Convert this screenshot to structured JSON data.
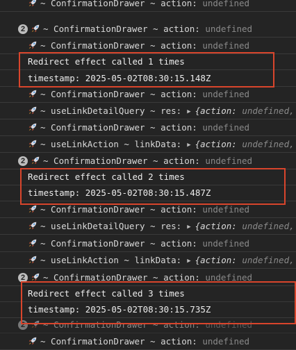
{
  "colors": {
    "background": "#242424",
    "text": "#e6e6e6",
    "undefined_text": "#8a8a8a",
    "highlight_box": "#d9452c",
    "badge_bg": "#bdbdbd"
  },
  "icons": {
    "log_prefix": "rocket-icon",
    "object_toggle": "triangle-right-icon"
  },
  "rows": [
    {
      "prefix": "~ ConfirmationDrawer ~ action:",
      "value": "undefined"
    },
    {
      "badge": "2",
      "prefix": "~ ConfirmationDrawer ~ action:",
      "value": "undefined"
    },
    {
      "prefix": "~ ConfirmationDrawer ~ action:",
      "value": "undefined"
    },
    {
      "message": "Redirect effect called 1 times"
    },
    {
      "message": "timestamp: 2025-05-02T08:30:15.148Z"
    },
    {
      "prefix": "~ ConfirmationDrawer ~ action:",
      "value": "undefined"
    },
    {
      "prefix": "~ useLinkDetailQuery ~ res:",
      "object": true,
      "obj_key": "{action:",
      "obj_value": "undefined,"
    },
    {
      "prefix": "~ ConfirmationDrawer ~ action:",
      "value": "undefined"
    },
    {
      "prefix": "~ useLinkAction ~ linkData:",
      "object": true,
      "obj_key": "{action:",
      "obj_value": "undefined,"
    },
    {
      "badge": "2",
      "prefix": "~ ConfirmationDrawer ~ action:",
      "value": "undefined"
    },
    {
      "message": "Redirect effect called 2 times"
    },
    {
      "message": "timestamp: 2025-05-02T08:30:15.487Z"
    },
    {
      "prefix": "~ ConfirmationDrawer ~ action:",
      "value": "undefined"
    },
    {
      "prefix": "~ useLinkDetailQuery ~ res:",
      "object": true,
      "obj_key": "{action:",
      "obj_value": "undefined,"
    },
    {
      "prefix": "~ ConfirmationDrawer ~ action:",
      "value": "undefined"
    },
    {
      "prefix": "~ useLinkAction ~ linkData:",
      "object": true,
      "obj_key": "{action:",
      "obj_value": "undefined,"
    },
    {
      "badge": "2",
      "prefix": "~ ConfirmationDrawer ~ action:",
      "value": "undefined"
    },
    {
      "message": "Redirect effect called 3 times"
    },
    {
      "message": "timestamp: 2025-05-02T08:30:15.735Z"
    },
    {
      "badge": "2",
      "prefix": "~ ConfirmationDrawer ~ action:",
      "value": "undefined"
    },
    {
      "prefix": "~ ConfirmationDrawer ~ action:",
      "value": "undefined"
    }
  ]
}
